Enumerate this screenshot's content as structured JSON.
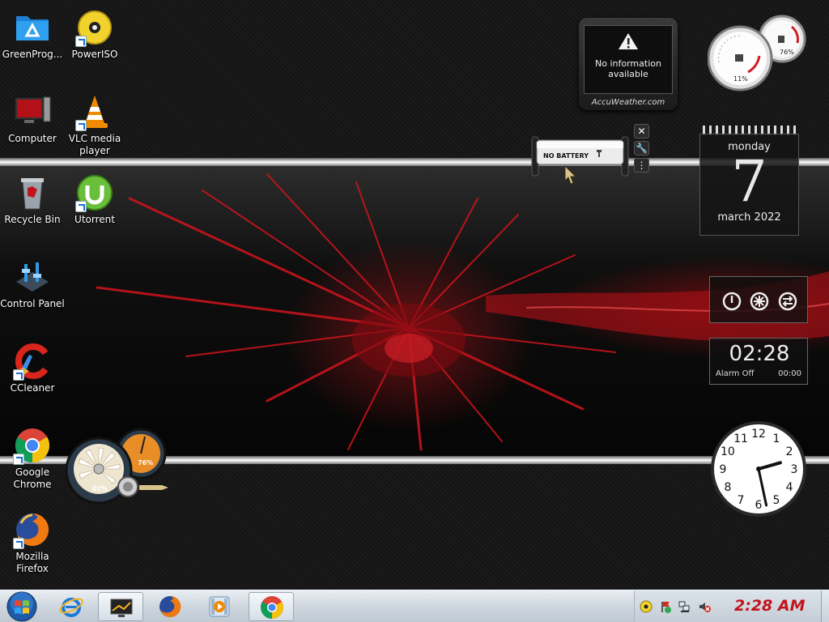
{
  "desktop_icons": [
    {
      "label": "GreenProg...",
      "icon": "folder-icon"
    },
    {
      "label": "PowerISO",
      "icon": "disc-icon"
    },
    {
      "label": "Computer",
      "icon": "computer-icon"
    },
    {
      "label": "VLC media player",
      "icon": "vlc-cone-icon"
    },
    {
      "label": "Recycle Bin",
      "icon": "recycle-bin-icon"
    },
    {
      "label": "Utorrent",
      "icon": "utorrent-icon"
    },
    {
      "label": "Control Panel",
      "icon": "control-panel-icon"
    },
    {
      "label": "CCleaner",
      "icon": "ccleaner-icon"
    },
    {
      "label": "Google Chrome",
      "icon": "chrome-icon"
    },
    {
      "label": "Mozilla Firefox",
      "icon": "firefox-icon"
    }
  ],
  "weather_gadget": {
    "message_line1": "No information",
    "message_line2": "available",
    "brand": "AccuWeather.com"
  },
  "battery_gadget": {
    "label": "NO BATTERY"
  },
  "cpu_meter": {
    "cpu_percent": "11%",
    "memory_percent": "76%",
    "cpu_value": 11,
    "memory_value": 76
  },
  "calendar": {
    "weekday": "monday",
    "day": "7",
    "month_year": "march 2022"
  },
  "alarm": {
    "time": "02:28",
    "status": "Alarm Off",
    "set_time": "00:00"
  },
  "analog_clock": {
    "numbers": [
      "12",
      "1",
      "2",
      "3",
      "4",
      "5",
      "6",
      "7",
      "8",
      "9",
      "10",
      "11"
    ],
    "hour": 2,
    "minute": 28
  },
  "drive_meter": {
    "left_percent": "02%",
    "right_percent": "76%",
    "left_value": 2,
    "right_value": 76
  },
  "taskbar": {
    "pinned": [
      {
        "name": "internet-explorer",
        "icon": "internet-explorer-icon"
      },
      {
        "name": "cpu-meter-gadget",
        "icon": "gadget-window-icon"
      },
      {
        "name": "firefox",
        "icon": "firefox-icon"
      },
      {
        "name": "media-player",
        "icon": "media-player-icon"
      },
      {
        "name": "chrome",
        "icon": "chrome-icon"
      }
    ],
    "tray_clock": "2:28 AM"
  },
  "colors": {
    "accent_red": "#c2141a",
    "taskbar": "#cfd7df"
  }
}
